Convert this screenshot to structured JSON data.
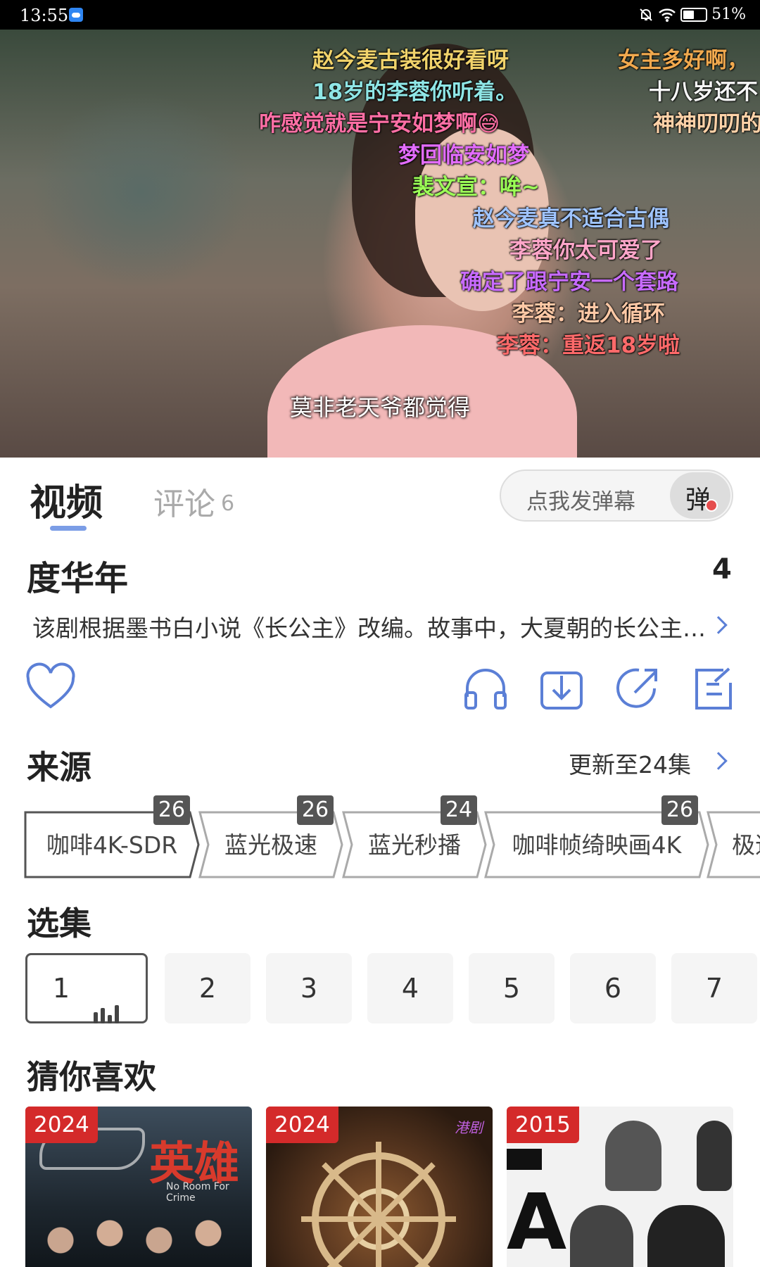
{
  "status_bar": {
    "time": "13:55",
    "battery": "51%"
  },
  "video": {
    "danmaku": [
      {
        "text": "赵今麦古装很好看呀",
        "color": "#f1d36b"
      },
      {
        "text": "18岁的李蓉你听着。",
        "color": "#8fe6e6"
      },
      {
        "text": "咋感觉就是宁安如梦啊😅",
        "color": "#ff6fa5"
      },
      {
        "text": "梦回临安如梦",
        "color": "#e36cff"
      },
      {
        "text": "裴文宣：哞~",
        "color": "#9cff57"
      },
      {
        "text": "赵今麦真不适合古偶",
        "color": "#9fc4ff"
      },
      {
        "text": "李蓉你太可爱了",
        "color": "#ffa6c9"
      },
      {
        "text": "确定了跟宁安一个套路",
        "color": "#c86bff"
      },
      {
        "text": "李蓉：进入循环",
        "color": "#ffc9a6"
      },
      {
        "text": "李蓉：重返18岁啦",
        "color": "#ff6a6a"
      },
      {
        "text": "女主多好啊，",
        "color": "#f1a94e"
      },
      {
        "text": "十八岁还不",
        "color": "#f6f6f6"
      },
      {
        "text": "神神叨叨的",
        "color": "#ffd2a8"
      }
    ],
    "subtitle": "莫非老天爷都觉得"
  },
  "tabs": {
    "video": "视频",
    "comments": "评论",
    "comments_count": "6"
  },
  "danmaku_input": {
    "placeholder": "点我发弹幕",
    "toggle_label": "弹"
  },
  "show": {
    "title": "度华年",
    "badge": "4",
    "description": "该剧根据墨书白小说《长公主》改编。故事中，大夏朝的长公主李蓉"
  },
  "actions": [
    "heart-icon",
    "headphones-icon",
    "download-icon",
    "share-icon",
    "edit-icon"
  ],
  "source_section": {
    "title": "来源",
    "updated": "更新至24集",
    "sources": [
      {
        "label": "咖啡4K-SDR",
        "count": "26",
        "selected": true
      },
      {
        "label": "蓝光极速",
        "count": "26",
        "selected": false
      },
      {
        "label": "蓝光秒播",
        "count": "24",
        "selected": false
      },
      {
        "label": "咖啡帧绮映画4K",
        "count": "26",
        "selected": false
      },
      {
        "label": "极速",
        "count": "",
        "selected": false
      }
    ]
  },
  "episodes_section": {
    "title": "选集",
    "episodes": [
      "1",
      "2",
      "3",
      "4",
      "5",
      "6",
      "7"
    ],
    "current": "1"
  },
  "recommend_section": {
    "title": "猜你喜欢",
    "items": [
      {
        "year": "2024",
        "poster_text": "英雄",
        "poster_subtext": "No Room For Crime",
        "accent": "#c83a2c"
      },
      {
        "year": "2024",
        "poster_text": "",
        "poster_subtext": "港剧",
        "accent": "#b06a2f"
      },
      {
        "year": "2015",
        "poster_text": "A",
        "poster_subtext": "",
        "accent": "#222222"
      }
    ]
  }
}
